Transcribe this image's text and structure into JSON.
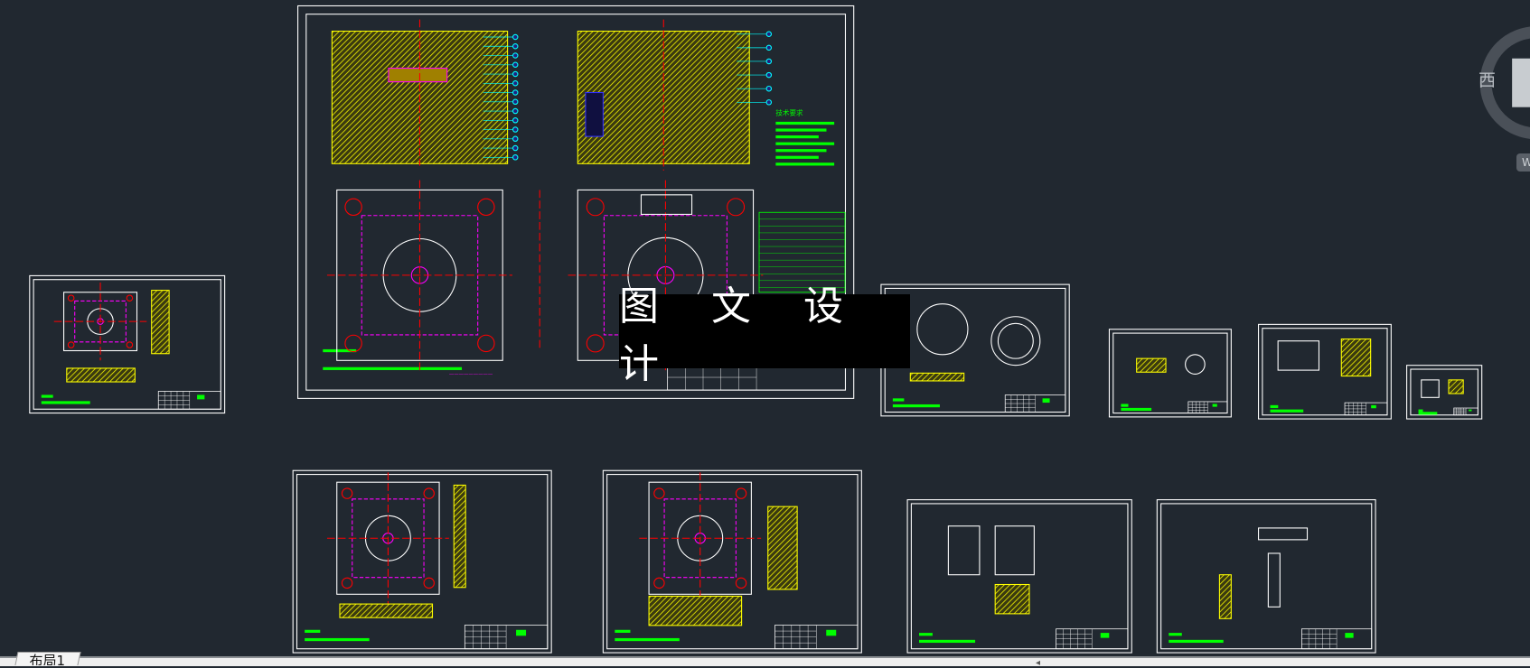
{
  "watermark": {
    "text": "图 文 设 计"
  },
  "viewcube": {
    "west_label": "西",
    "wcs_label": "W"
  },
  "layout_tabs": [
    {
      "label": "布局1",
      "active": true
    }
  ],
  "drawing": {
    "notes_title": "技术要求",
    "colors": {
      "background": "#212830",
      "frame": "#ffffff",
      "part": "#ffff00",
      "dimension": "#00ffff",
      "center": "#ff0000",
      "text": "#00ff00",
      "highlight": "#ff00ff"
    }
  }
}
